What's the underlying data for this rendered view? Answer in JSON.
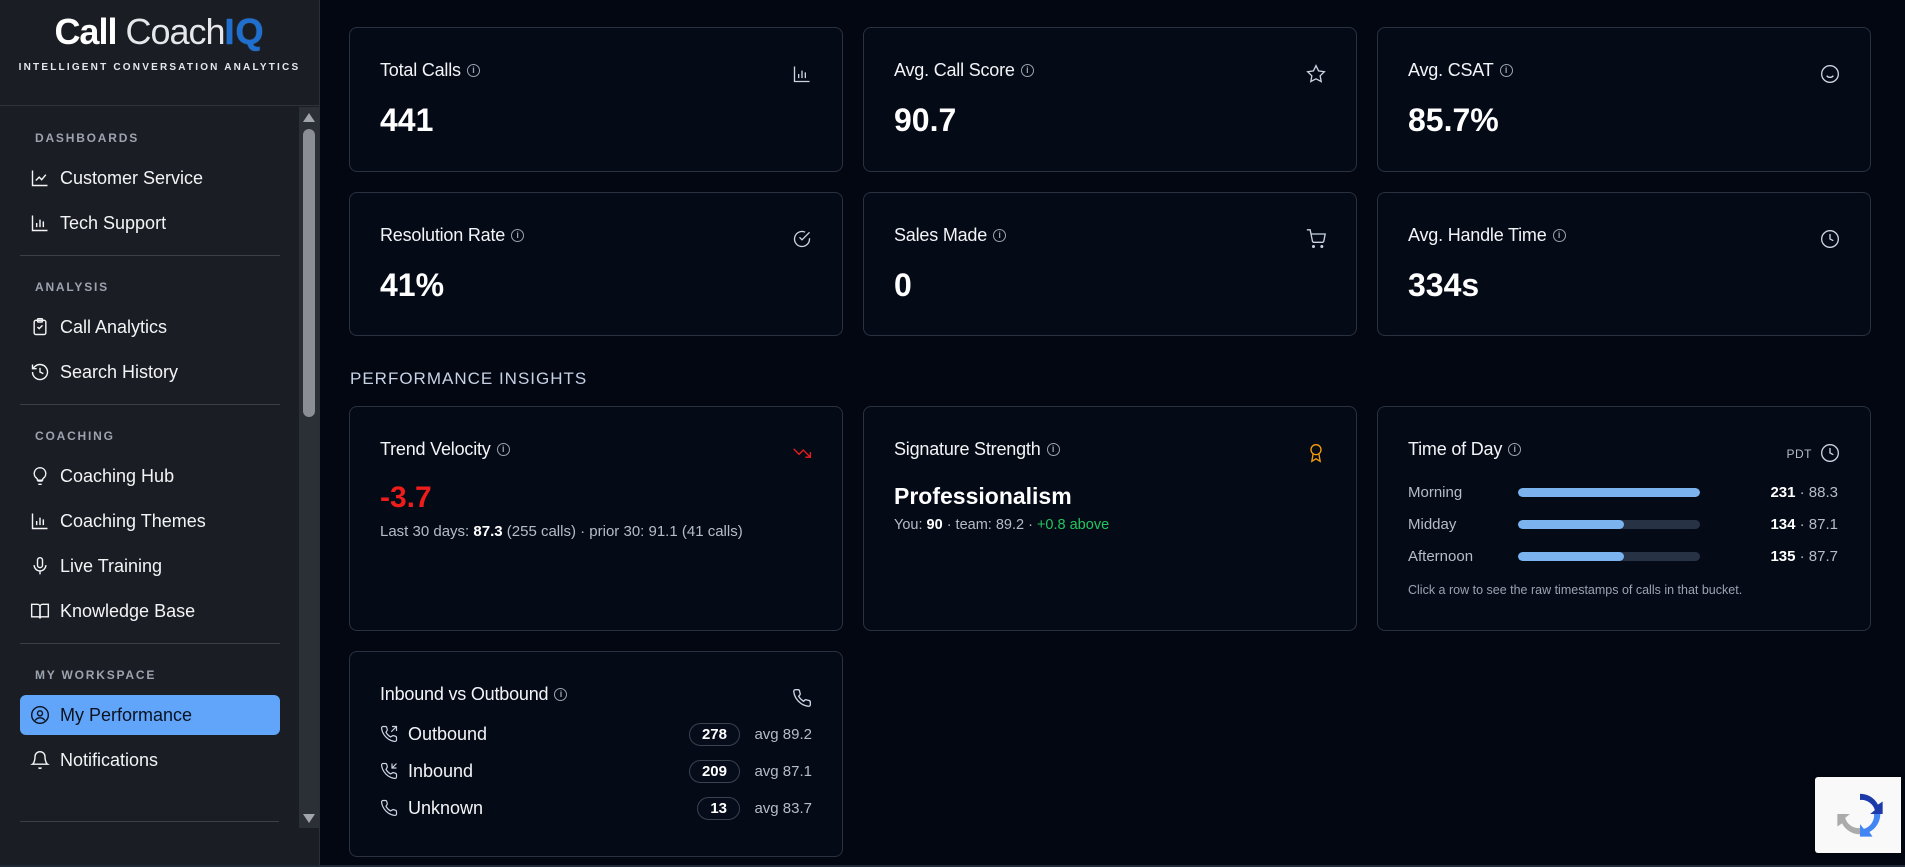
{
  "brand": {
    "logo_bold": "Call",
    "logo_light": " Coach",
    "logo_iq": "IQ",
    "tagline": "INTELLIGENT CONVERSATION ANALYTICS"
  },
  "sidebar": {
    "sections": [
      {
        "title": "DASHBOARDS",
        "items": [
          {
            "label": "Customer Service",
            "icon": "line-chart-icon"
          },
          {
            "label": "Tech Support",
            "icon": "bar-chart-icon"
          }
        ]
      },
      {
        "title": "ANALYSIS",
        "items": [
          {
            "label": "Call Analytics",
            "icon": "clipboard-icon"
          },
          {
            "label": "Search History",
            "icon": "history-icon"
          }
        ]
      },
      {
        "title": "COACHING",
        "items": [
          {
            "label": "Coaching Hub",
            "icon": "lightbulb-icon"
          },
          {
            "label": "Coaching Themes",
            "icon": "bar-chart-icon"
          },
          {
            "label": "Live Training",
            "icon": "microphone-icon"
          },
          {
            "label": "Knowledge Base",
            "icon": "book-icon"
          }
        ]
      },
      {
        "title": "MY WORKSPACE",
        "items": [
          {
            "label": "My Performance",
            "icon": "user-circle-icon",
            "active": true
          },
          {
            "label": "Notifications",
            "icon": "bell-icon"
          }
        ]
      }
    ]
  },
  "kpis": [
    {
      "title": "Total Calls",
      "value": "441",
      "icon": "bar-chart-icon"
    },
    {
      "title": "Avg. Call Score",
      "value": "90.7",
      "icon": "star-icon"
    },
    {
      "title": "Avg. CSAT",
      "value": "85.7%",
      "icon": "smile-icon"
    },
    {
      "title": "Resolution Rate",
      "value": "41%",
      "icon": "check-circle-icon"
    },
    {
      "title": "Sales Made",
      "value": "0",
      "icon": "cart-icon"
    },
    {
      "title": "Avg. Handle Time",
      "value": "334s",
      "icon": "clock-icon"
    }
  ],
  "insights": {
    "section_title": "PERFORMANCE INSIGHTS",
    "trend": {
      "title": "Trend Velocity",
      "value": "-3.7",
      "prefix": "Last 30 days: ",
      "recent": "87.3",
      "recent_calls": " (255 calls) · prior 30: 91.1 (41 calls)"
    },
    "signature": {
      "title": "Signature Strength",
      "strength": "Professionalism",
      "you_label": "You: ",
      "you_value": "90",
      "team": " · team: 89.2 · ",
      "delta": "+0.8 above"
    },
    "time_of_day": {
      "title": "Time of Day",
      "tz": "PDT",
      "rows": [
        {
          "label": "Morning",
          "calls": "231",
          "avg": " · 88.3",
          "fill": 1.0
        },
        {
          "label": "Midday",
          "calls": "134",
          "avg": " · 87.1",
          "fill": 0.58
        },
        {
          "label": "Afternoon",
          "calls": "135",
          "avg": " · 87.7",
          "fill": 0.58
        }
      ],
      "hint": "Click a row to see the raw timestamps of calls in that bucket."
    },
    "inbound_outbound": {
      "title": "Inbound vs Outbound",
      "rows": [
        {
          "label": "Outbound",
          "count": "278",
          "avg": "avg 89.2"
        },
        {
          "label": "Inbound",
          "count": "209",
          "avg": "avg 87.1"
        },
        {
          "label": "Unknown",
          "count": "13",
          "avg": "avg 83.7"
        }
      ]
    }
  }
}
